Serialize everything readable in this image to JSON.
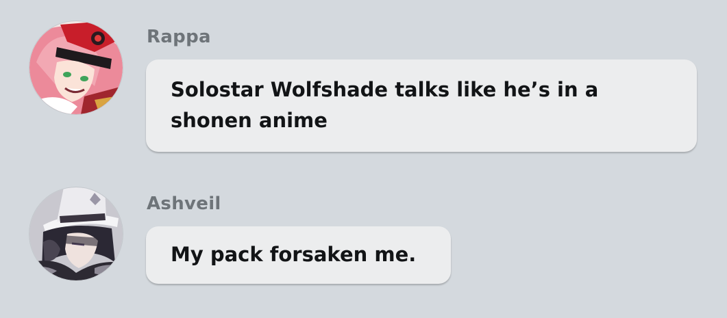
{
  "messages": [
    {
      "sender": "Rappa",
      "text": "Solostar Wolfshade talks like he’s in a shonen anime",
      "avatar_icon": "rappa-avatar-icon"
    },
    {
      "sender": "Ashveil",
      "text": "My pack forsaken me.",
      "avatar_icon": "ashveil-avatar-icon"
    }
  ],
  "colors": {
    "background": "#d4d9de",
    "bubble": "#ecedee",
    "sender_name": "#6e7479",
    "message_text": "#121416"
  }
}
